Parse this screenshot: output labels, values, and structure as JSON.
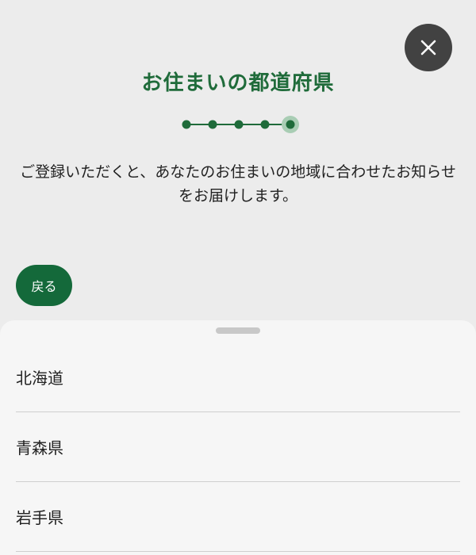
{
  "header": {
    "title": "お住まいの都道府県",
    "description": "ご登録いただくと、あなたのお住まいの地域に合わせたお知らせをお届けします。",
    "close_icon": "close-icon"
  },
  "stepper": {
    "total_steps": 5,
    "current_step": 5
  },
  "actions": {
    "back_label": "戻る"
  },
  "sheet": {
    "prefectures": [
      {
        "label": "北海道"
      },
      {
        "label": "青森県"
      },
      {
        "label": "岩手県"
      }
    ]
  },
  "colors": {
    "brand_green": "#1f6b3a",
    "button_green": "#14693a",
    "close_button": "#424242",
    "background": "#ececec",
    "sheet_background": "#f6f6f6"
  }
}
